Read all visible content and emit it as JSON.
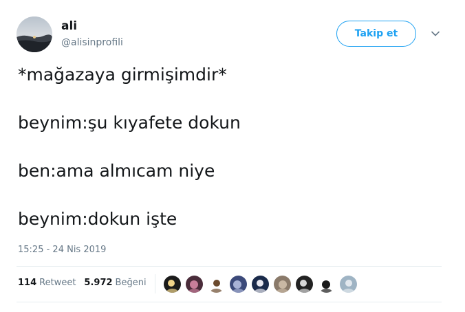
{
  "user": {
    "display_name": "ali",
    "handle": "@alisinprofili"
  },
  "follow_button": {
    "label": "Takip et"
  },
  "tweet": {
    "lines": [
      "*mağazaya girmişimdir*",
      "beynim:şu kıyafete dokun",
      "ben:ama almıcam niye",
      "beynim:dokun işte"
    ],
    "timestamp": "15:25 - 24 Nis 2019"
  },
  "stats": {
    "retweet_count": "114",
    "retweet_label": "Retweet",
    "like_count": "5.972",
    "like_label": "Beğeni"
  },
  "likers": [
    {
      "colors": [
        "#1b1b1b",
        "#f0d48a"
      ]
    },
    {
      "colors": [
        "#4a2c3a",
        "#c87e9a"
      ]
    },
    {
      "colors": [
        "#ffffff",
        "#6b4a2e"
      ]
    },
    {
      "colors": [
        "#3c4a7a",
        "#a8b2d6"
      ]
    },
    {
      "colors": [
        "#1a2a4a",
        "#e8e8f0"
      ]
    },
    {
      "colors": [
        "#8a7a6a",
        "#c9b8a4"
      ]
    },
    {
      "colors": [
        "#222222",
        "#d8d8d8"
      ]
    },
    {
      "colors": [
        "#ffffff",
        "#1a1a1a"
      ]
    },
    {
      "colors": [
        "#9fb4c4",
        "#e2e8ee"
      ]
    }
  ],
  "colors": {
    "accent": "#1da1f2",
    "secondary_text": "#657786",
    "primary_text": "#14171a",
    "divider": "#e6ecf0"
  },
  "icons": {
    "caret": "chevron-down-icon",
    "avatar": "profile-photo"
  }
}
